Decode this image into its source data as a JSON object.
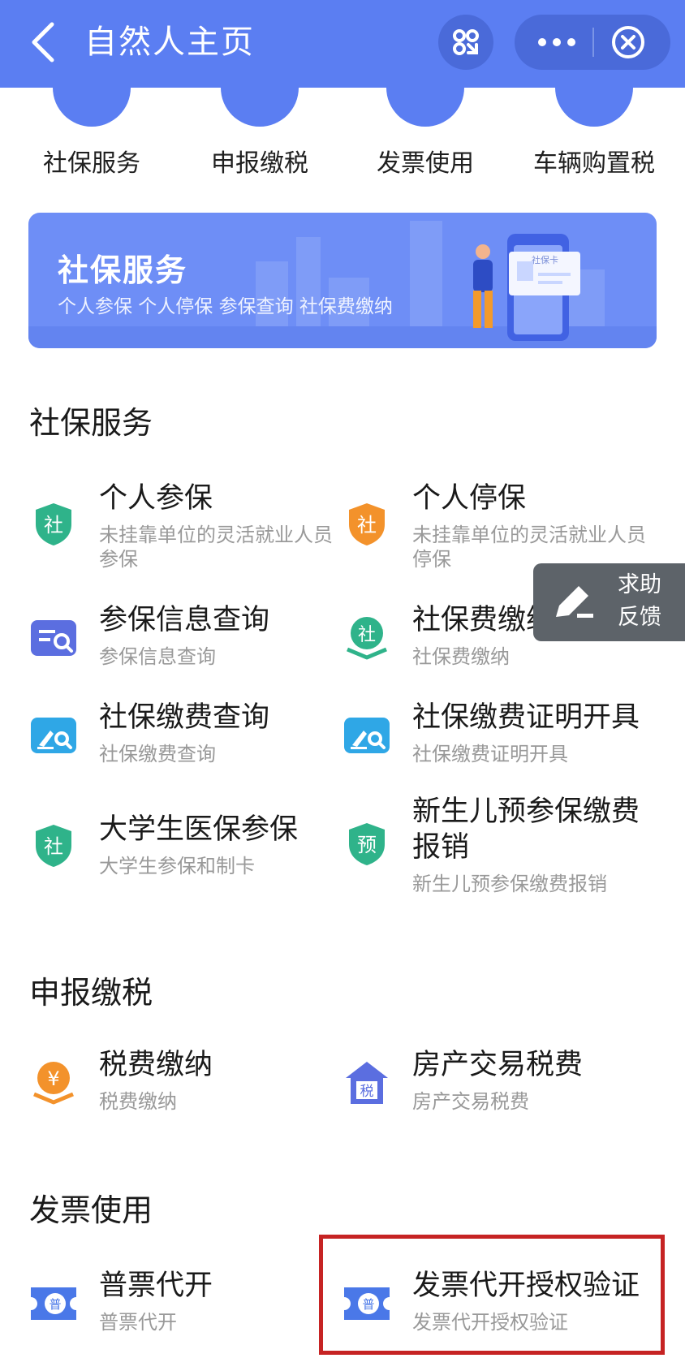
{
  "header": {
    "title": "自然人主页",
    "back_icon": "chevron-left-icon",
    "qr_icon": "mini-program-icon",
    "more_icon": "more-dots-icon",
    "close_icon": "close-circle-icon"
  },
  "top_categories": [
    {
      "label": "社保服务"
    },
    {
      "label": "申报缴税"
    },
    {
      "label": "发票使用"
    },
    {
      "label": "车辆购置税"
    }
  ],
  "banner": {
    "title": "社保服务",
    "subtitle": "个人参保 个人停保 参保查询 社保费缴纳",
    "card_text": "社保卡"
  },
  "sections": {
    "social": {
      "title": "社保服务",
      "items": [
        {
          "title": "个人参保",
          "desc": "未挂靠单位的灵活就业人员参保",
          "icon": "shield-social-icon",
          "icon_char": "社",
          "color": "#2fb38a"
        },
        {
          "title": "个人停保",
          "desc": "未挂靠单位的灵活就业人员停保",
          "icon": "shield-social-stop-icon",
          "icon_char": "社",
          "color": "#f3922b"
        },
        {
          "title": "参保信息查询",
          "desc": "参保信息查询",
          "icon": "list-search-icon",
          "color": "#5b6ee0"
        },
        {
          "title": "社保费缴纳",
          "desc": "社保费缴纳",
          "icon": "social-pay-icon",
          "icon_char": "社",
          "color": "#2fb38a"
        },
        {
          "title": "社保缴费查询",
          "desc": "社保缴费查询",
          "icon": "edit-search-icon",
          "color": "#2fa7e6"
        },
        {
          "title": "社保缴费证明开具",
          "desc": "社保缴费证明开具",
          "icon": "edit-search-icon",
          "color": "#2fa7e6"
        },
        {
          "title": "大学生医保参保",
          "desc": "大学生参保和制卡",
          "icon": "shield-social-icon",
          "icon_char": "社",
          "color": "#2fb38a"
        },
        {
          "title": "新生儿预参保缴费报销",
          "desc": "新生儿预参保缴费报销",
          "icon": "shield-pre-icon",
          "icon_char": "预",
          "color": "#2fb38a"
        }
      ]
    },
    "tax": {
      "title": "申报缴税",
      "items": [
        {
          "title": "税费缴纳",
          "desc": "税费缴纳",
          "icon": "yuan-pay-icon",
          "icon_char": "¥",
          "color": "#f3922b"
        },
        {
          "title": "房产交易税费",
          "desc": "房产交易税费",
          "icon": "house-tax-icon",
          "icon_char": "税",
          "color": "#5b6ee0"
        }
      ]
    },
    "invoice": {
      "title": "发票使用",
      "items": [
        {
          "title": "普票代开",
          "desc": "普票代开",
          "icon": "ticket-icon",
          "icon_char": "普",
          "color": "#4a78e8"
        },
        {
          "title": "发票代开授权验证",
          "desc": "发票代开授权验证",
          "icon": "ticket-icon",
          "icon_char": "普",
          "color": "#4a78e8"
        }
      ]
    }
  },
  "help_button": {
    "line1": "求助",
    "line2": "反馈",
    "icon": "pencil-icon"
  }
}
